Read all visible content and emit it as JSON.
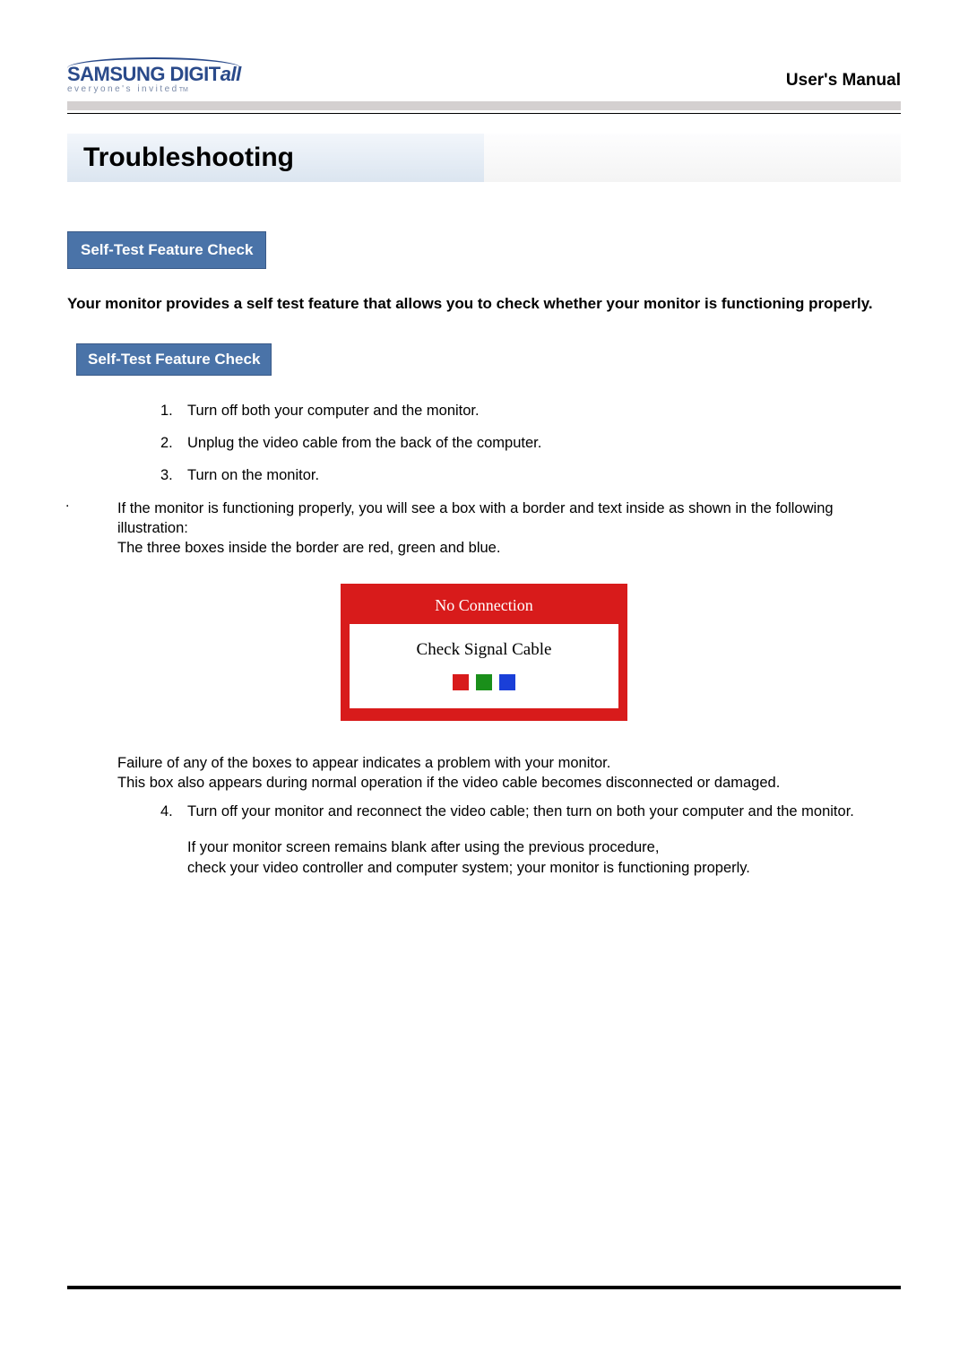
{
  "header": {
    "logo_brand": "SAMSUNG DIGIT",
    "logo_italic": "all",
    "logo_tag": "everyone's invited",
    "logo_tm": "TM",
    "manual": "User's Manual"
  },
  "page_title": "Troubleshooting",
  "section_pill": "Self-Test Feature Check",
  "intro": "Your monitor provides a self test feature that allows you to check whether your monitor is functioning properly.",
  "sub_pill": "Self-Test Feature Check",
  "steps": [
    "Turn off both your computer and the monitor.",
    "Unplug the video cable from the back of the computer.",
    "Turn on the monitor."
  ],
  "after_steps_1": "If the monitor is functioning properly, you will see a box with a border and  text inside as shown in the following illustration:",
  "after_steps_2": "The three boxes inside the border are red, green and blue.",
  "illustration": {
    "header": "No Connection",
    "body": "Check Signal Cable"
  },
  "post_ill_1": "Failure of any of the boxes to appear indicates a problem with your monitor.",
  "post_ill_2": "This box also appears during normal operation if the video cable becomes disconnected or damaged.",
  "step4": "Turn off your monitor and reconnect the video cable; then turn on both your computer and the monitor.",
  "step4_follow_1": "If your monitor screen remains blank after using the previous procedure,",
  "step4_follow_2": "check your video controller and computer system; your monitor is functioning properly.",
  "nums": {
    "n1": "1.",
    "n2": "2.",
    "n3": "3.",
    "n4": "4."
  }
}
